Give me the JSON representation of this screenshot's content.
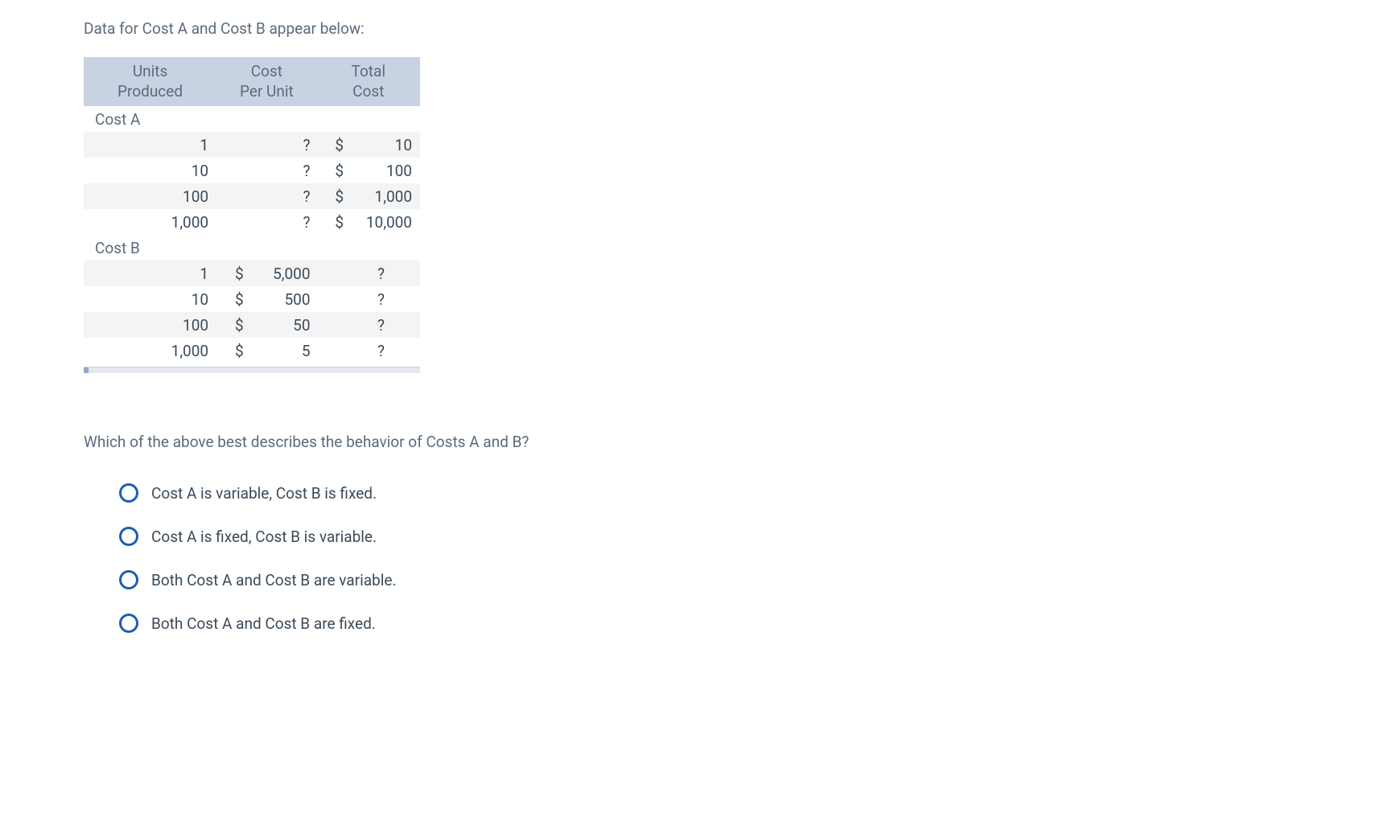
{
  "intro": "Data for Cost A and Cost B appear below:",
  "headers": {
    "units": "Units\nProduced",
    "cpu": "Cost\nPer Unit",
    "total": "Total\nCost"
  },
  "sections": {
    "a": {
      "label": "Cost A",
      "rows": [
        {
          "units": "1",
          "cpu_sym": "",
          "cpu": "?",
          "tot_sym": "$",
          "tot": "10"
        },
        {
          "units": "10",
          "cpu_sym": "",
          "cpu": "?",
          "tot_sym": "$",
          "tot": "100"
        },
        {
          "units": "100",
          "cpu_sym": "",
          "cpu": "?",
          "tot_sym": "$",
          "tot": "1,000"
        },
        {
          "units": "1,000",
          "cpu_sym": "",
          "cpu": "?",
          "tot_sym": "$",
          "tot": "10,000"
        }
      ]
    },
    "b": {
      "label": "Cost B",
      "rows": [
        {
          "units": "1",
          "cpu_sym": "$",
          "cpu": "5,000",
          "tot_sym": "",
          "tot": "?"
        },
        {
          "units": "10",
          "cpu_sym": "$",
          "cpu": "500",
          "tot_sym": "",
          "tot": "?"
        },
        {
          "units": "100",
          "cpu_sym": "$",
          "cpu": "50",
          "tot_sym": "",
          "tot": "?"
        },
        {
          "units": "1,000",
          "cpu_sym": "$",
          "cpu": "5",
          "tot_sym": "",
          "tot": "?"
        }
      ]
    }
  },
  "question": "Which of the above best describes the behavior of Costs A and B?",
  "options": [
    "Cost A is variable, Cost B is fixed.",
    "Cost A is fixed, Cost B is variable.",
    "Both Cost A and Cost B are variable.",
    "Both Cost A and Cost B are fixed."
  ]
}
